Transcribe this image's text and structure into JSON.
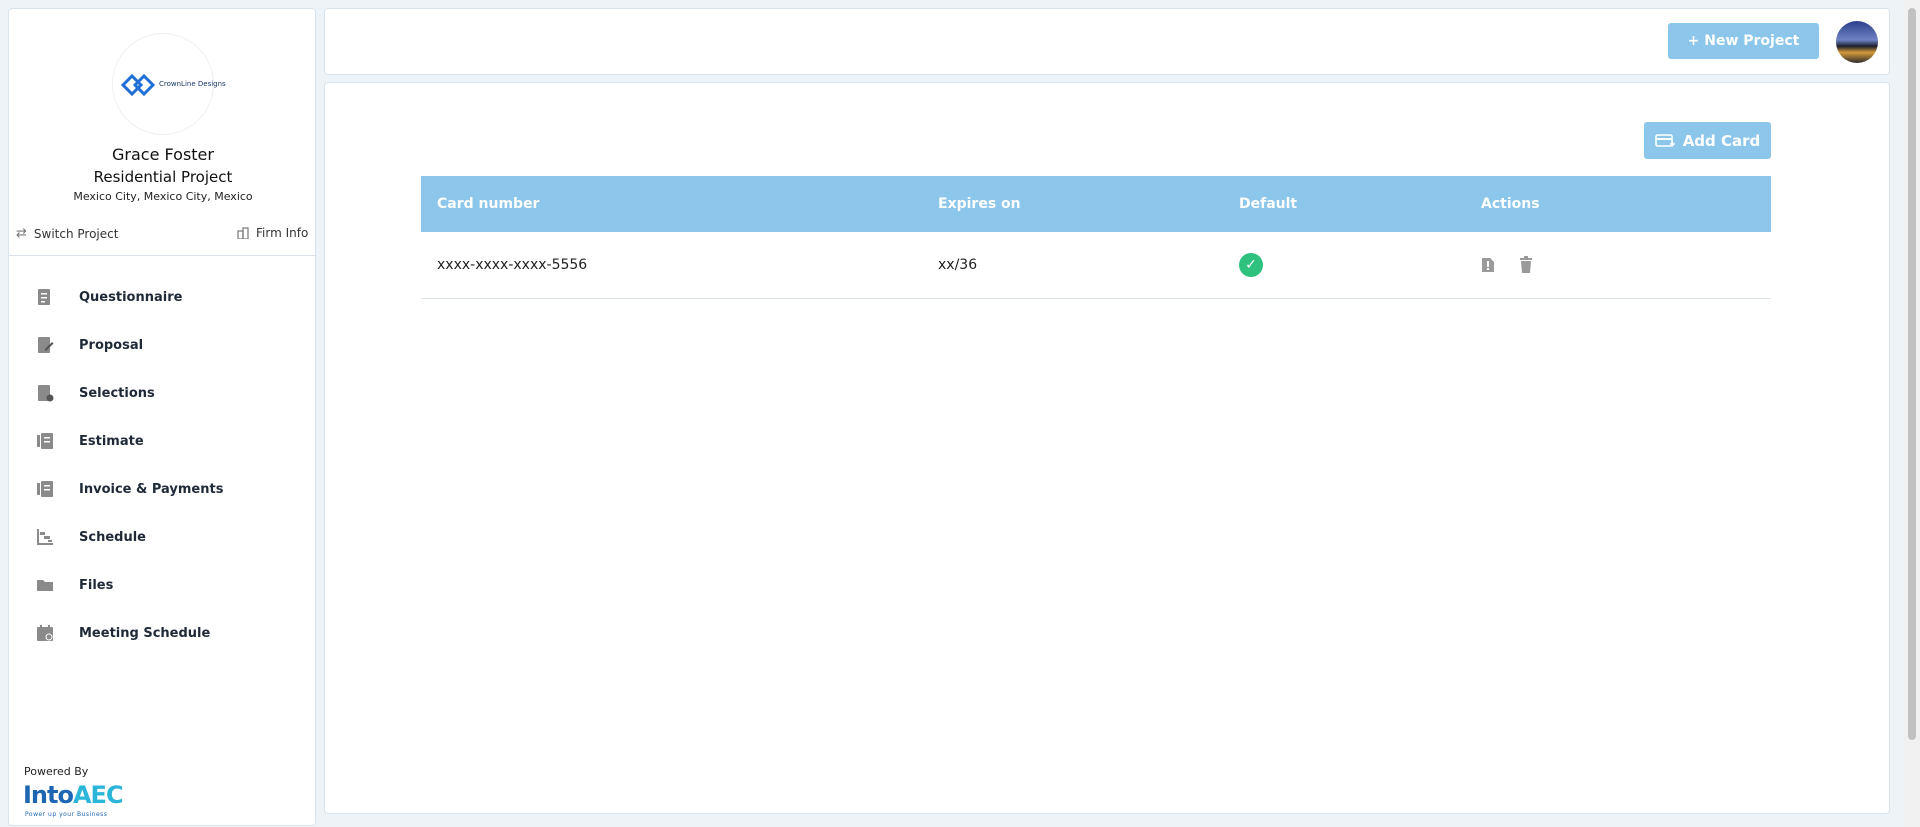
{
  "profile": {
    "logo_text": "CrownLine Designs",
    "name": "Grace Foster",
    "project": "Residential Project",
    "location": "Mexico City, Mexico City, Mexico"
  },
  "links": {
    "switch_project": "Switch Project",
    "firm_info": "Firm Info"
  },
  "nav": [
    {
      "label": "Questionnaire",
      "icon": "questionnaire-icon"
    },
    {
      "label": "Proposal",
      "icon": "proposal-icon"
    },
    {
      "label": "Selections",
      "icon": "selections-icon"
    },
    {
      "label": "Estimate",
      "icon": "estimate-icon"
    },
    {
      "label": "Invoice & Payments",
      "icon": "invoice-icon"
    },
    {
      "label": "Schedule",
      "icon": "schedule-icon"
    },
    {
      "label": "Files",
      "icon": "folder-icon"
    },
    {
      "label": "Meeting Schedule",
      "icon": "calendar-icon"
    }
  ],
  "footer": {
    "powered_by": "Powered By",
    "brand_part1": "Into",
    "brand_part2": "AEC",
    "brand_tagline": "Power up your Business"
  },
  "header": {
    "new_project": "+ New Project"
  },
  "cards": {
    "add_card": "Add Card",
    "columns": [
      "Card number",
      "Expires on",
      "Default",
      "Actions"
    ],
    "rows": [
      {
        "number": "xxxx-xxxx-xxxx-5556",
        "expires": "xx/36",
        "default": true
      }
    ]
  },
  "colors": {
    "accent": "#8cc6ea",
    "success": "#2ec27e",
    "brand_blue": "#1d66b3"
  }
}
